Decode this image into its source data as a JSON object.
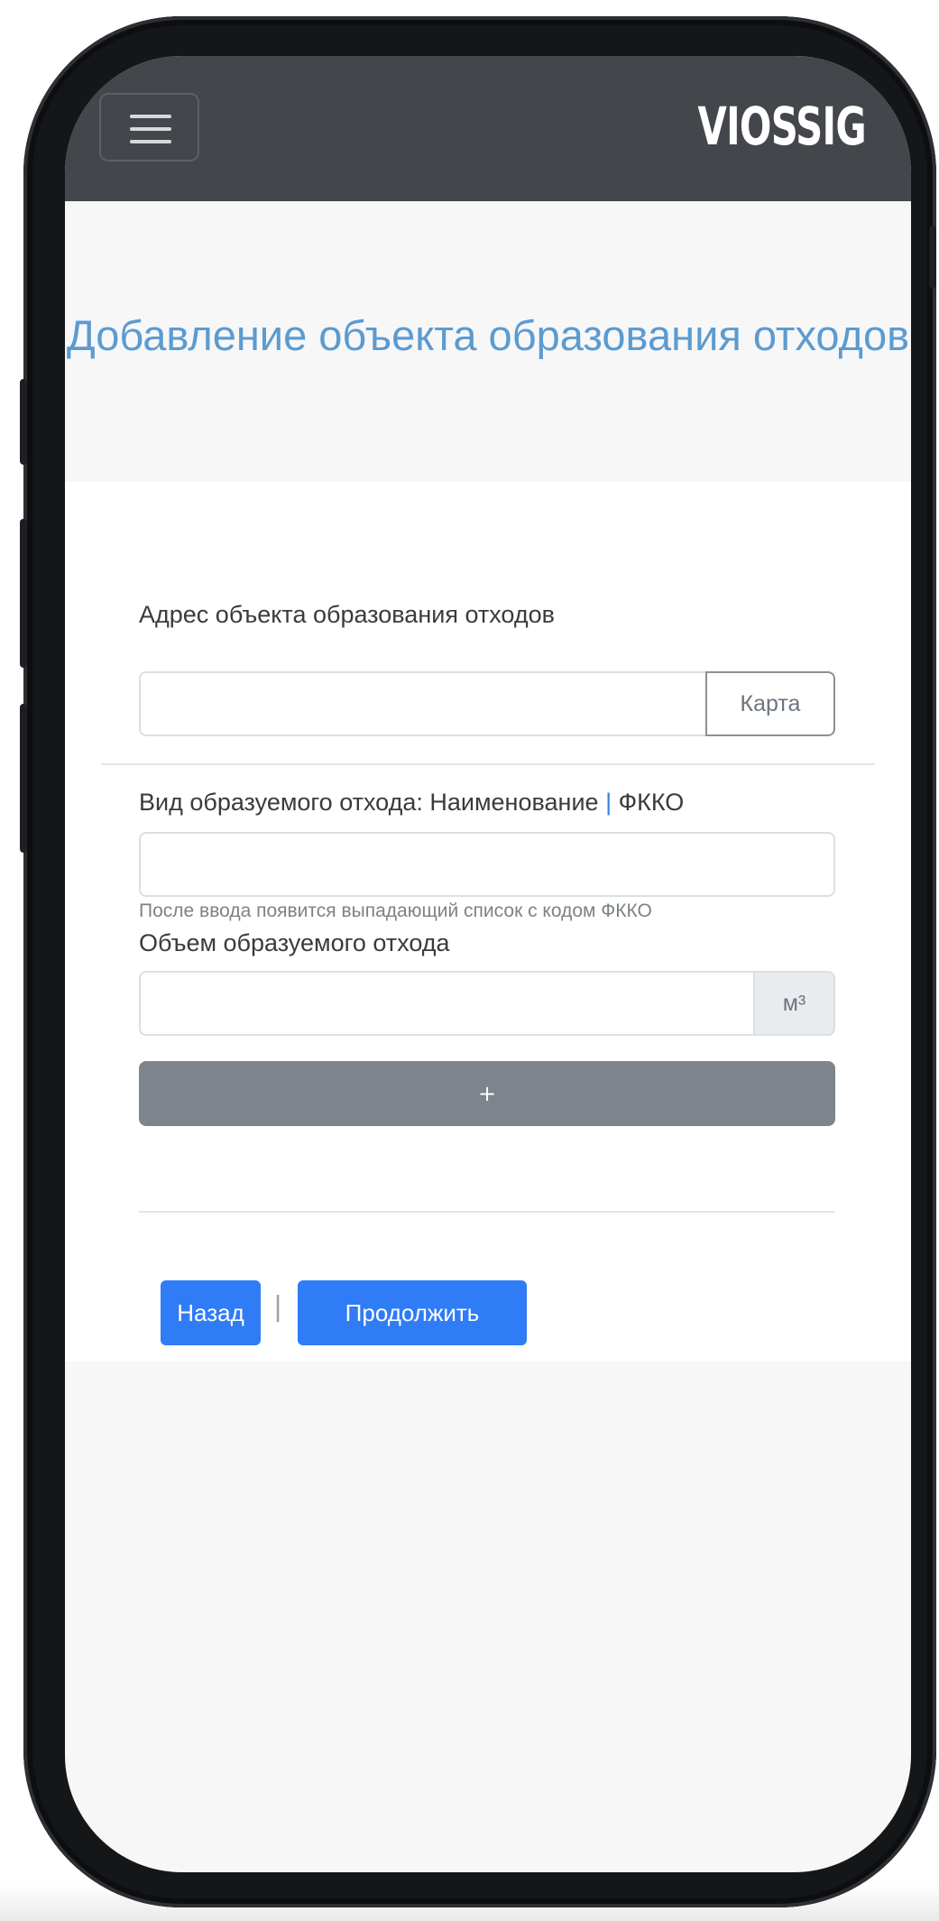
{
  "navbar": {
    "menu_icon": "hamburger-menu-icon",
    "brand": "VIOSSIG"
  },
  "page": {
    "title": "Добавление объекта образования отходов"
  },
  "form": {
    "address": {
      "label": "Адрес объекта образования отходов",
      "value": "",
      "map_button": "Карта"
    },
    "waste_type": {
      "label_prefix": "Вид образуемого отхода: Наименование ",
      "label_pipe": "|",
      "label_suffix": " ФККО",
      "value": "",
      "hint": "После ввода появится выпадающий список с кодом ФККО"
    },
    "volume": {
      "label": "Объем образуемого отхода",
      "value": "",
      "unit": "м³"
    },
    "add_button": "+",
    "back_button": "Назад",
    "separator": "|",
    "continue_button": "Продолжить"
  },
  "colors": {
    "navbar": "#43464b",
    "title": "#5b9bd0",
    "primary": "#2f7cf6",
    "secondary": "#7d848c"
  }
}
